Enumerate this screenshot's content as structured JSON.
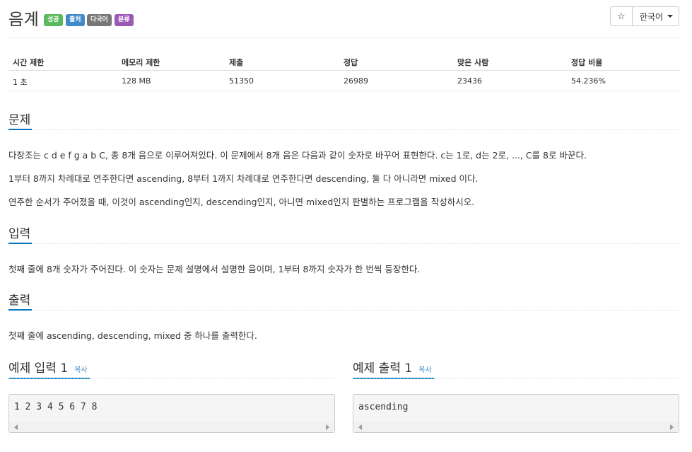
{
  "problem": {
    "title": "음계",
    "badges": [
      "성공",
      "출처",
      "다국어",
      "분류"
    ]
  },
  "toolbar": {
    "star_icon": "☆",
    "language": "한국어"
  },
  "stats": {
    "headers": [
      "시간 제한",
      "메모리 제한",
      "제출",
      "정답",
      "맞은 사람",
      "정답 비율"
    ],
    "values": [
      "1 초",
      "128 MB",
      "51350",
      "26989",
      "23436",
      "54.236%"
    ]
  },
  "sections": {
    "problem": {
      "title": "문제",
      "paragraphs": [
        "다장조는 c d e f g a b C, 총 8개 음으로 이루어져있다. 이 문제에서 8개 음은 다음과 같이 숫자로 바꾸어 표현한다. c는 1로, d는 2로, ..., C를 8로 바꾼다.",
        "1부터 8까지 차례대로 연주한다면 ascending, 8부터 1까지 차례대로 연주한다면 descending, 둘 다 아니라면 mixed 이다.",
        "연주한 순서가 주어졌을 때, 이것이 ascending인지, descending인지, 아니면 mixed인지 판별하는 프로그램을 작성하시오."
      ]
    },
    "input": {
      "title": "입력",
      "text": "첫째 줄에 8개 숫자가 주어진다. 이 숫자는 문제 설명에서 설명한 음이며, 1부터 8까지 숫자가 한 번씩 등장한다."
    },
    "output": {
      "title": "출력",
      "text": "첫째 줄에 ascending, descending, mixed 중 하나를 출력한다."
    }
  },
  "samples": {
    "input": {
      "title": "예제 입력 1",
      "copy": "복사",
      "content": "1 2 3 4 5 6 7 8"
    },
    "output": {
      "title": "예제 출력 1",
      "copy": "복사",
      "content": "ascending"
    }
  }
}
